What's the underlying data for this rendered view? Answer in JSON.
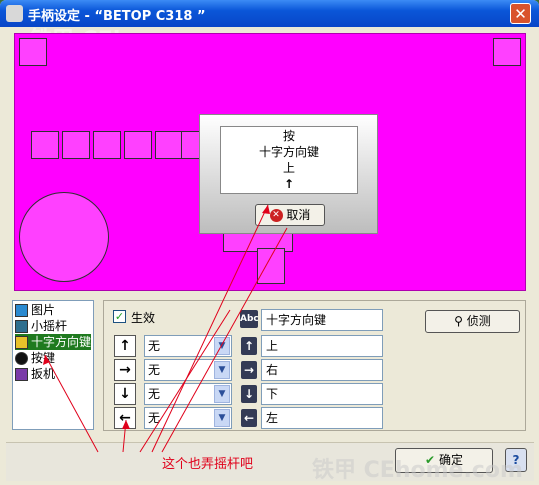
{
  "window": {
    "title": "手柄设定 - “BETOP C318 ”",
    "close_label": "✕"
  },
  "popup": {
    "line1": "按",
    "line2": "十字方向键",
    "line3": "上",
    "arrow": "↑",
    "cancel_label": "取消"
  },
  "list": {
    "items": [
      "图片",
      "小摇杆",
      "十字方向键",
      "按键",
      "扳机"
    ]
  },
  "config": {
    "enabled_label": "生效",
    "enabled_checked": "✓",
    "name_value": "十字方向键",
    "name_icon": "Abc",
    "rows": [
      {
        "btn": "↑",
        "select": "无",
        "dir_icon": "↑",
        "dir": "上"
      },
      {
        "btn": "→",
        "select": "无",
        "dir_icon": "→",
        "dir": "右"
      },
      {
        "btn": "↓",
        "select": "无",
        "dir_icon": "↓",
        "dir": "下"
      },
      {
        "btn": "←",
        "select": "无",
        "dir_icon": "←",
        "dir": "左"
      }
    ],
    "detect_label": "侦测"
  },
  "footer": {
    "ok_label": "确定",
    "help_label": "?"
  },
  "annotation": {
    "text": "这个也弄摇杆吧",
    "color": "#e0001a"
  },
  "watermark": {
    "top": "铁甲 CEhome.com",
    "bottom": "铁甲 CEhome.com"
  },
  "colors": {
    "pad": "#ff00ff",
    "title": "#0a56d8",
    "annotation": "#e0001a"
  }
}
